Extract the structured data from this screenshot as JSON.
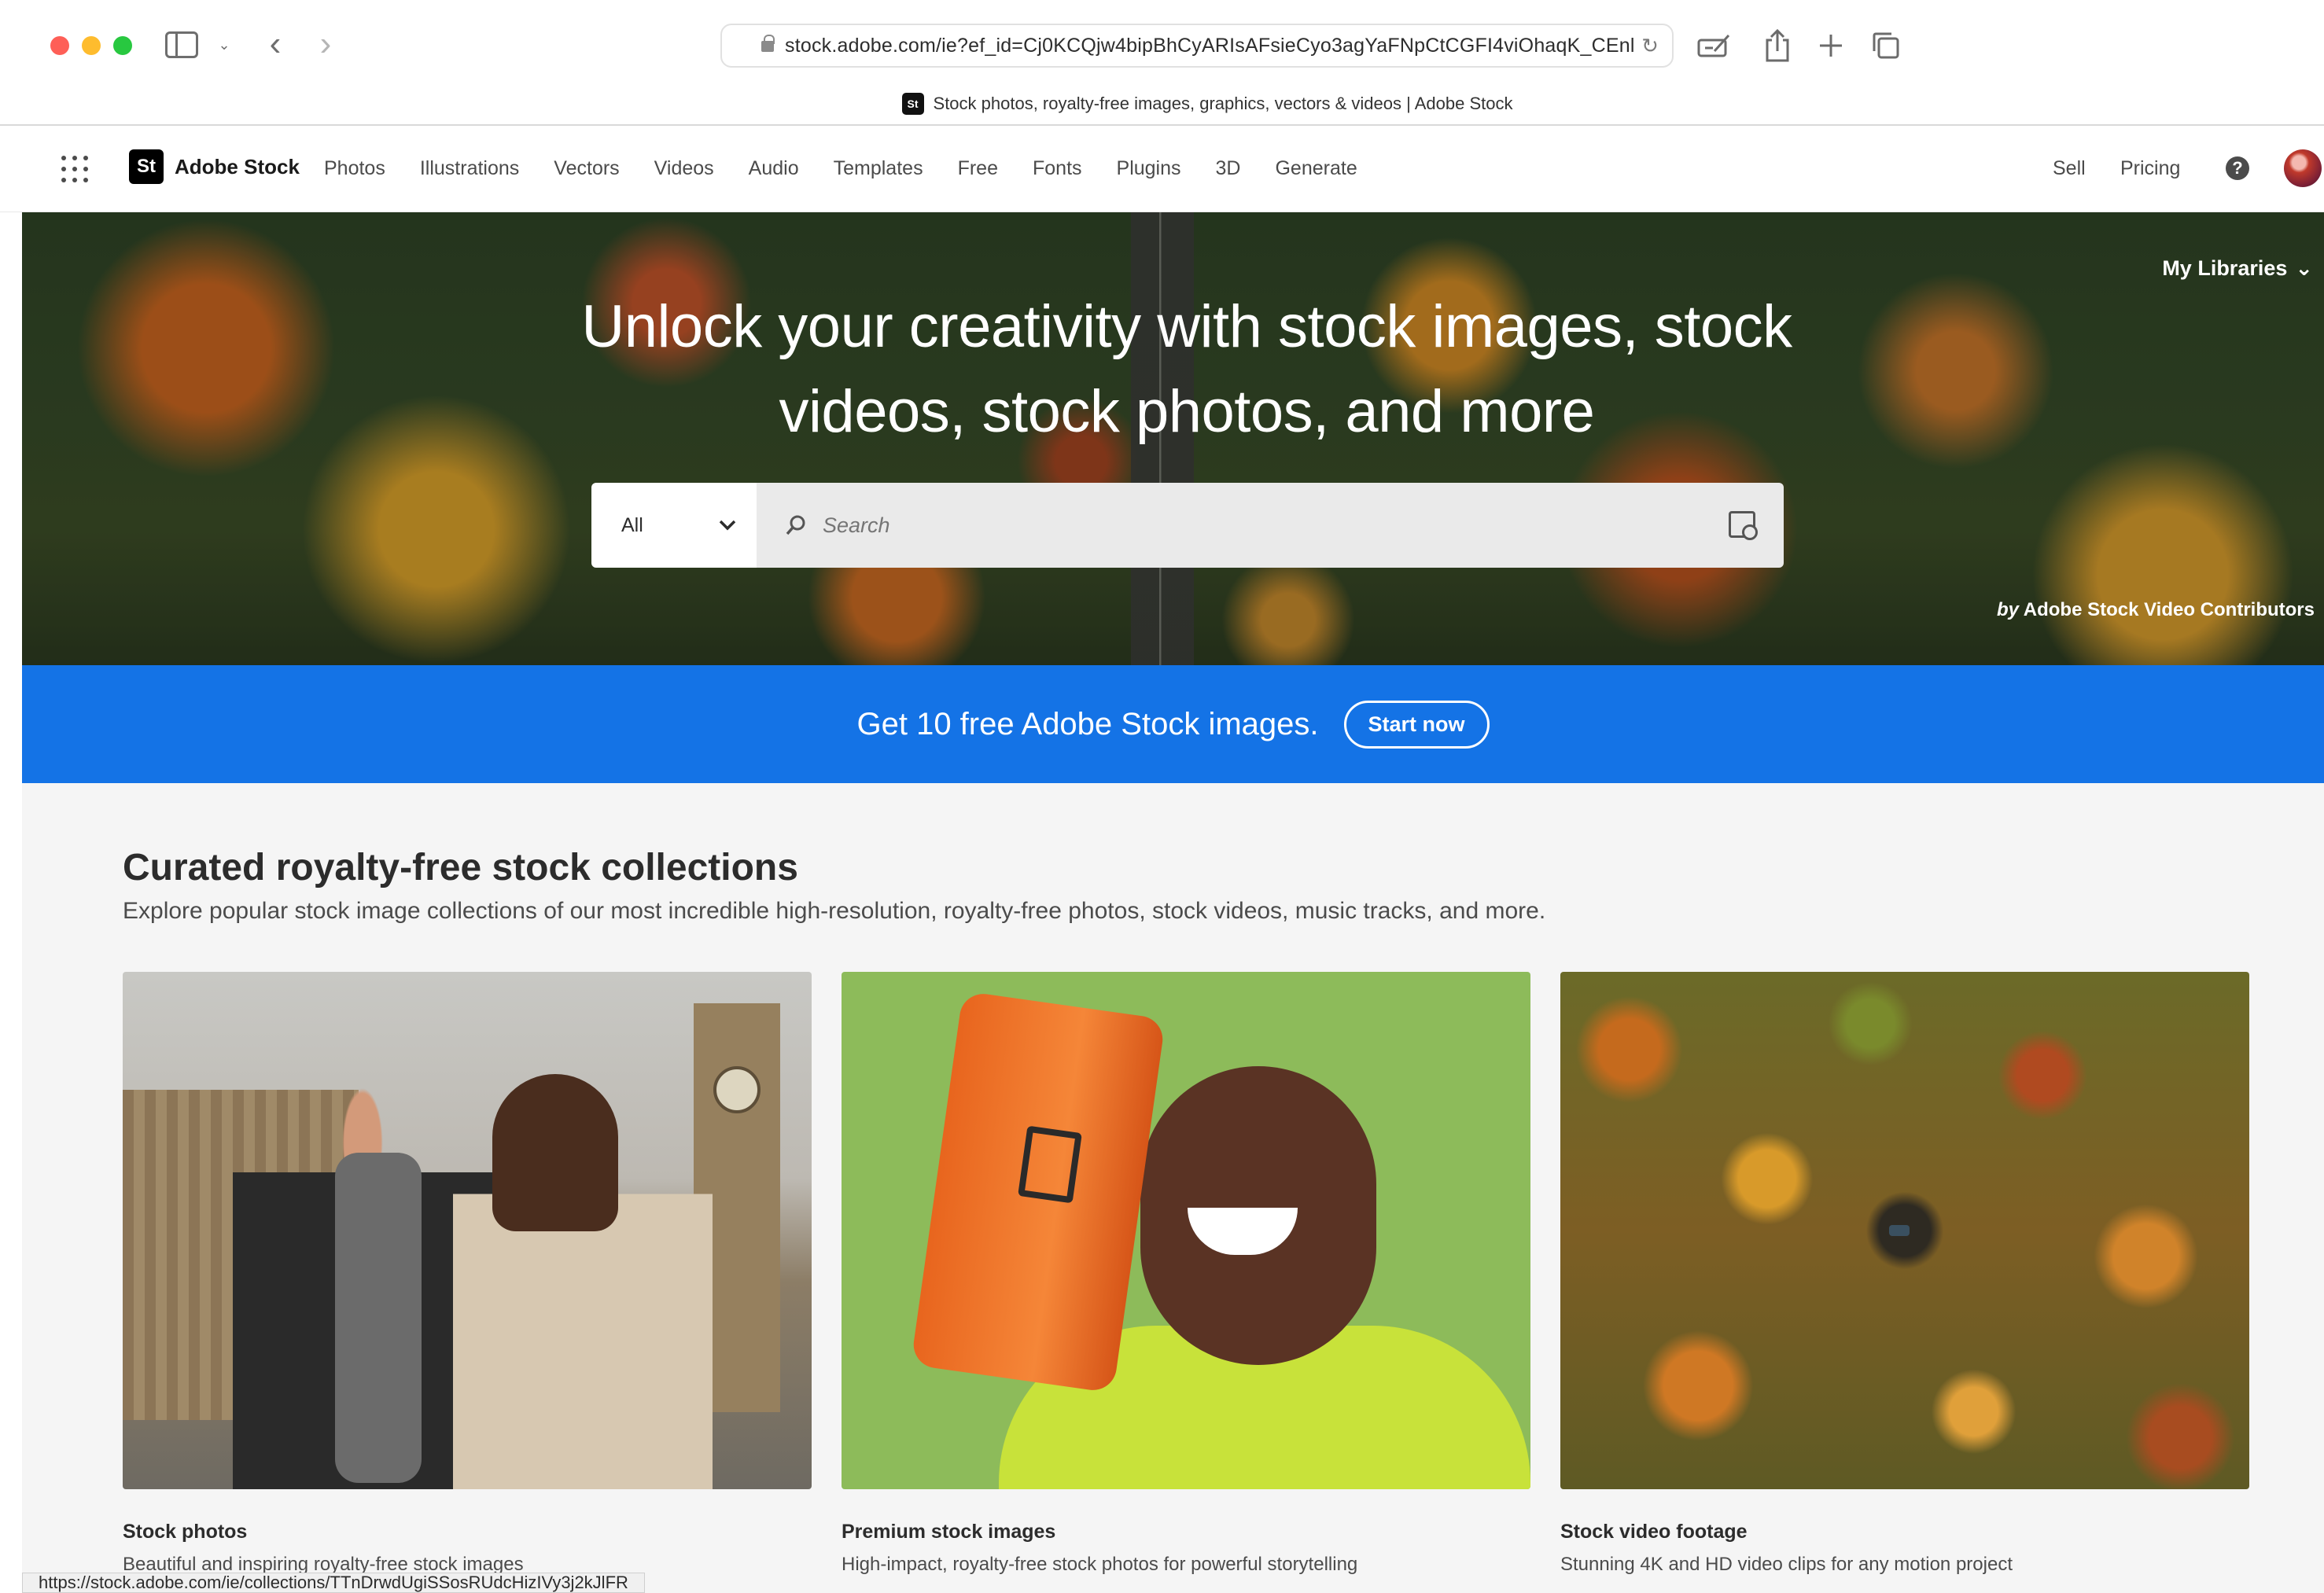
{
  "browser": {
    "url": "stock.adobe.com/ie?ef_id=Cj0KCQjw4bipBhCyARIsAFsieCyo3agYaFNpCtCGFI4viOhaqK_CEnl",
    "tab_title": "Stock photos, royalty-free images, graphics, vectors & videos | Adobe Stock",
    "favicon_text": "St",
    "status_url": "https://stock.adobe.com/ie/collections/TTnDrwdUgiSSosRUdcHizIVy3j2kJlFR"
  },
  "nav": {
    "brand_logo": "St",
    "brand_name": "Adobe Stock",
    "links": [
      "Photos",
      "Illustrations",
      "Vectors",
      "Videos",
      "Audio",
      "Templates",
      "Free",
      "Fonts",
      "Plugins",
      "3D",
      "Generate"
    ],
    "sell": "Sell",
    "pricing": "Pricing",
    "help": "?"
  },
  "hero": {
    "my_libraries": "My Libraries",
    "title_line1": "Unlock your creativity with stock images, stock",
    "title_line2": "videos, stock photos, and more",
    "filter_value": "All",
    "search_placeholder": "Search",
    "credit_by": "by",
    "credit_name": "Adobe Stock Video Contributors"
  },
  "promo": {
    "text": "Get 10 free Adobe Stock images.",
    "button": "Start now"
  },
  "collections": {
    "title": "Curated royalty-free stock collections",
    "subtitle": "Explore popular stock image collections of our most incredible high-resolution, royalty-free photos, stock videos, music tracks, and more.",
    "cards": [
      {
        "name": "Stock photos",
        "desc": "Beautiful and inspiring royalty-free stock images"
      },
      {
        "name": "Premium stock images",
        "desc": "High-impact, royalty-free stock photos for powerful storytelling"
      },
      {
        "name": "Stock video footage",
        "desc": "Stunning 4K and HD video clips for any motion project"
      }
    ]
  },
  "colors": {
    "promo_blue": "#1473e6",
    "close": "#fe5f57",
    "minimize": "#febc2e",
    "maximize": "#28c840"
  }
}
